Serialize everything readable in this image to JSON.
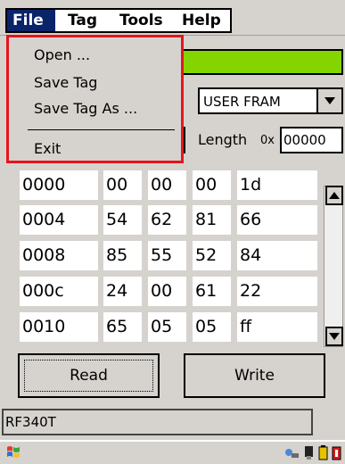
{
  "menu": {
    "file": "File",
    "tag": "Tag",
    "tools": "Tools",
    "help": "Help"
  },
  "file_menu": {
    "open": "Open ...",
    "save_tag": "Save Tag",
    "save_tag_as": "Save Tag As ...",
    "exit": "Exit"
  },
  "memory": {
    "selected": "USER FRAM",
    "length_label": "Length",
    "length_prefix": "0x",
    "length_value": "00000"
  },
  "grid": {
    "rows": [
      {
        "addr": "0000",
        "bytes": [
          "00",
          "00",
          "00",
          "1d"
        ]
      },
      {
        "addr": "0004",
        "bytes": [
          "54",
          "62",
          "81",
          "66"
        ]
      },
      {
        "addr": "0008",
        "bytes": [
          "85",
          "55",
          "52",
          "84"
        ]
      },
      {
        "addr": "000c",
        "bytes": [
          "24",
          "00",
          "61",
          "22"
        ]
      },
      {
        "addr": "0010",
        "bytes": [
          "65",
          "05",
          "05",
          "ff"
        ]
      }
    ]
  },
  "buttons": {
    "read": "Read",
    "write": "Write"
  },
  "status": {
    "device": "RF340T"
  },
  "colors": {
    "accent_green": "#84d400",
    "menu_highlight": "#0a246a",
    "annotation_red": "#e4151e"
  },
  "icons": [
    "windows-start-icon",
    "network-icon",
    "battery-icon",
    "pen-icon",
    "power-icon"
  ]
}
